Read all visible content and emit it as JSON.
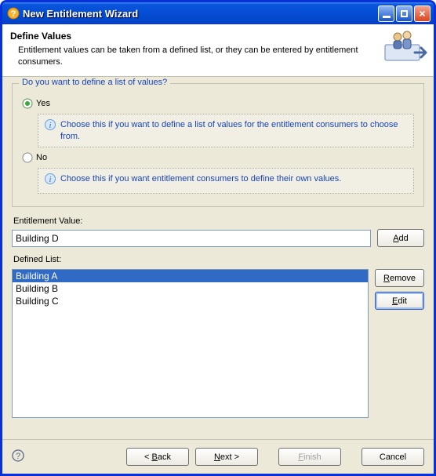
{
  "window": {
    "title": "New Entitlement Wizard"
  },
  "banner": {
    "heading": "Define Values",
    "desc": "Entitlement values can be taken from a defined list, or they can be entered by entitlement consumers."
  },
  "group": {
    "legend": "Do you want to define a list of values?",
    "yes_label": "Yes",
    "yes_selected": true,
    "yes_hint": "Choose this if you want to define a list of values for the entitlement consumers to choose from.",
    "no_label": "No",
    "no_selected": false,
    "no_hint": "Choose this if you want entitlement consumers to define their own values."
  },
  "value_input": {
    "label": "Entitlement Value:",
    "value": "Building D",
    "add_label": "Add"
  },
  "defined_list": {
    "label": "Defined List:",
    "items": [
      {
        "label": "Building A",
        "selected": true
      },
      {
        "label": "Building B",
        "selected": false
      },
      {
        "label": "Building C",
        "selected": false
      }
    ],
    "remove_label": "Remove",
    "edit_label": "Edit"
  },
  "footer": {
    "back": "< Back",
    "next": "Next >",
    "finish": "Finish",
    "cancel": "Cancel"
  }
}
